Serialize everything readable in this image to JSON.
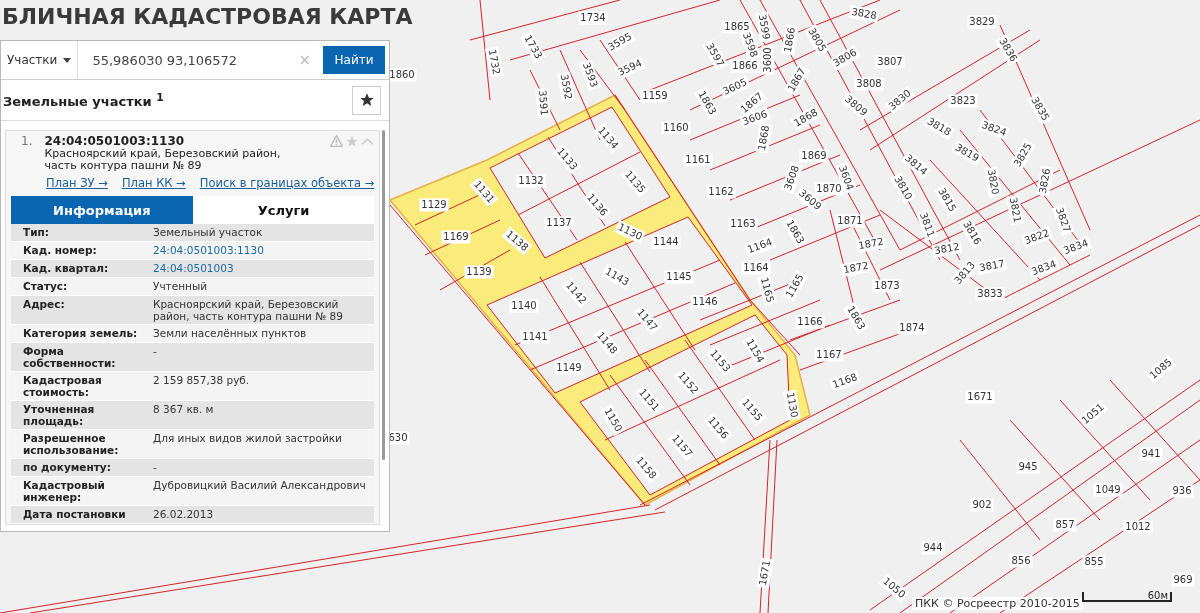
{
  "header": {
    "title": "БЛИЧНАЯ КАДАСТРОВАЯ КАРТА"
  },
  "search": {
    "category": "Участки",
    "value": "55,986030 93,106572",
    "clear": "×",
    "button": "Найти"
  },
  "results": {
    "title": "Земельные участки $^{1}$"
  },
  "result": {
    "index": "1.",
    "number": "24:04:0501003:1130",
    "address": "Красноярский край, Березовский район, часть контура пашни № 89",
    "links": [
      "План ЗУ →",
      "План КК →",
      "Поиск в границах объекта →"
    ],
    "tabs": [
      {
        "label": "Информация",
        "selected": true
      },
      {
        "label": "Услуги",
        "selected": false
      }
    ],
    "rows": [
      {
        "label": "Тип:",
        "value": "Земельный участок",
        "kind": "text"
      },
      {
        "label": "Кад. номер:",
        "value": "24:04:0501003:1130",
        "kind": "link"
      },
      {
        "label": "Кад. квартал:",
        "value": "24:04:0501003",
        "kind": "link"
      },
      {
        "label": "Статус:",
        "value": "Учтенный",
        "kind": "text"
      },
      {
        "label": "Адрес:",
        "value": "Красноярский край, Березовский район, часть контура пашни № 89",
        "kind": "text"
      },
      {
        "label": "Категория земель:",
        "value": "Земли населённых пунктов",
        "kind": "text"
      },
      {
        "label": "Форма собственности:",
        "value": "-",
        "kind": "text"
      },
      {
        "label": "Кадастровая стоимость:",
        "value": "2 159 857,38 руб.",
        "kind": "text"
      },
      {
        "label": "Уточненная площадь:",
        "value": "8 367 кв. м",
        "kind": "text"
      },
      {
        "label": "Разрешенное использование:",
        "value": "Для иных видов жилой застройки",
        "kind": "text"
      },
      {
        "label": "по документу:",
        "value": "-",
        "kind": "text"
      },
      {
        "label": "Кадастровый инженер:",
        "value": "Дубровицкий Василий Александрович",
        "kind": "text"
      },
      {
        "label": "Дата постановки",
        "value": "26.02.2013",
        "kind": "text"
      }
    ]
  },
  "map": {
    "labels": [
      "1734",
      "1733",
      "1732",
      "1860",
      "3595",
      "3594",
      "3593",
      "3592",
      "3591",
      "1159",
      "1160",
      "1161",
      "1162",
      "1163",
      "1164",
      "1164",
      "1165",
      "1165",
      "1863",
      "1863",
      "1863",
      "1865",
      "3597",
      "3598",
      "3599",
      "3600",
      "1866",
      "1866",
      "3605",
      "1867",
      "1867",
      "3606",
      "1868",
      "1868",
      "3608",
      "1869",
      "3604",
      "1870",
      "3609",
      "1871",
      "1872",
      "1872",
      "1873",
      "1874",
      "1166",
      "1167",
      "1168",
      "1130",
      "1130",
      "3828",
      "3829",
      "3836",
      "3805",
      "3806",
      "3807",
      "3808",
      "3809",
      "3830",
      "3823",
      "3824",
      "3818",
      "3819",
      "3825",
      "3835",
      "3814",
      "3820",
      "3826",
      "3810",
      "3815",
      "3821",
      "3827",
      "3811",
      "3816",
      "3822",
      "3834",
      "3812",
      "3817",
      "3834",
      "3813",
      "3833",
      "1129",
      "1131",
      "1132",
      "1133",
      "1134",
      "1135",
      "1136",
      "1137",
      "1169",
      "1138",
      "1139",
      "1144",
      "1143",
      "1145",
      "1142",
      "1146",
      "1140",
      "1147",
      "1141",
      "1148",
      "1149",
      "1154",
      "1153",
      "1152",
      "1151",
      "1155",
      "1150",
      "1156",
      "1157",
      "1158",
      "1671",
      "1671",
      "1085",
      "1051",
      "945",
      "941",
      "902",
      "1049",
      "936",
      "857",
      "1012",
      "944",
      "856",
      "855",
      "1050",
      "969",
      "630"
    ],
    "copyright": "ПКК © Росреестр 2010-2015",
    "scale": "60м"
  }
}
